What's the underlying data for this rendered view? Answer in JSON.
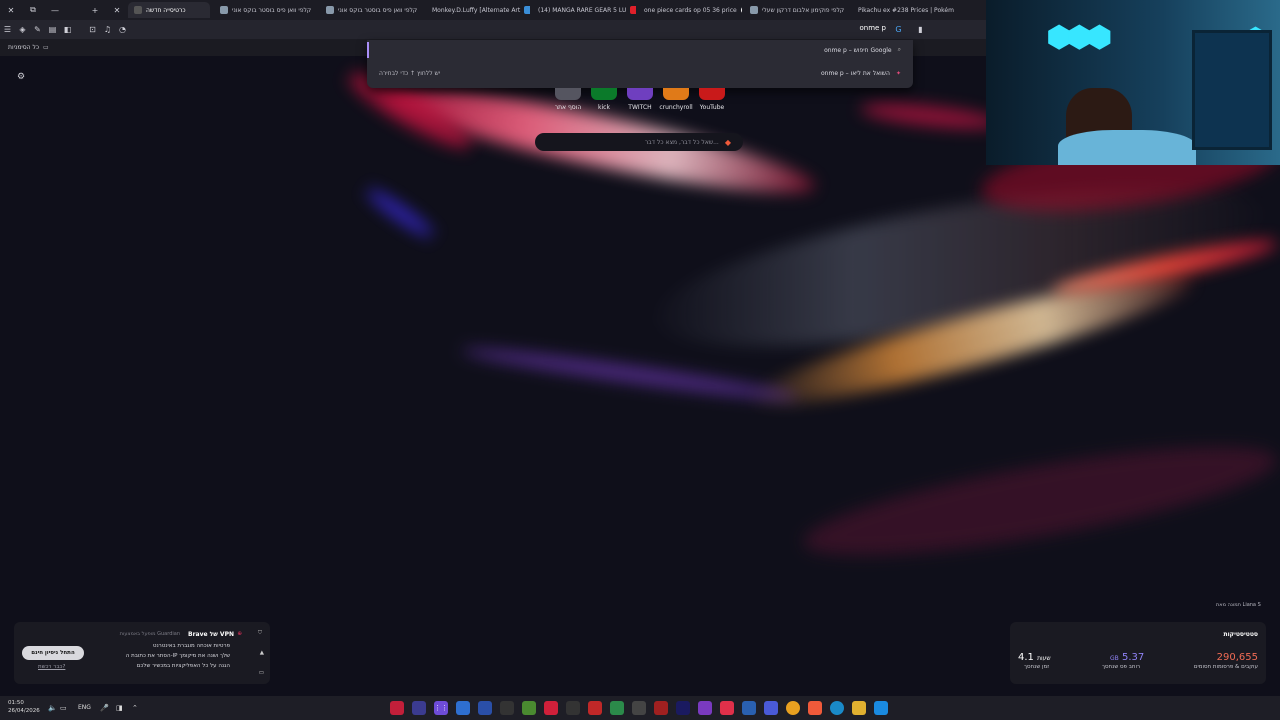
{
  "browser": {
    "tabs": [
      {
        "title": "כרטיסייה חדשה",
        "active": true
      },
      {
        "title": "קלפי וואן פיס בוסטר בוקס אוני"
      },
      {
        "title": "קלפי וואן פיס בוסטר בוקס אוני"
      },
      {
        "title": "Monkey.D.Luffy [Alternate Art"
      },
      {
        "title": "(14) MANGA RARE GEAR 5 LU"
      },
      {
        "title": "one piece cards op 05 36 price"
      },
      {
        "title": "קלפי פוקימון אלבום דרקון שעלי"
      },
      {
        "title": "Pikachu ex #238 Prices | Pokém"
      }
    ],
    "address_value": "onme p",
    "bookmarks_label": "כל הסימניות",
    "suggestions": [
      {
        "text": "onme p – חיפוש Google",
        "icon": "search-icon"
      },
      {
        "text": "onme p – השואל את ליאו",
        "sub": "יש ללחוץ ↑ כדי לבחירה",
        "icon": "leo-icon"
      }
    ]
  },
  "newtab": {
    "shortcuts": [
      {
        "label": "הוסף אתר",
        "color": "#555560"
      },
      {
        "label": "kick",
        "color": "#0b7a2a"
      },
      {
        "label": "TWITCH",
        "color": "#6f3fbf"
      },
      {
        "label": "crunchyroll",
        "color": "#e07a18"
      },
      {
        "label": "YouTube",
        "color": "#c91a1a"
      }
    ],
    "ask_placeholder": "שאל כל דבר, מצא כל דבר...",
    "photo_credit": "תמונה מאת Liana S"
  },
  "vpn_widget": {
    "title": "Brave של VPN",
    "guardian": "מופעל באמצעות Guardian",
    "features": [
      "פרטיות אוכחה מוגברת באינטרנט",
      "הסתר את כתובת ה-IP שלך ושנה את מיקומך",
      "הגנה על כל האפליקציות במכשיר שלכם"
    ],
    "cta": "התחל ניסיון חינם",
    "link": "כבר רכשת?"
  },
  "stats_widget": {
    "title": "סטטיסטיקות",
    "items": [
      {
        "value": "290,655",
        "label": "עוקבים & פרסומות חסומים",
        "color": "#f06b54"
      },
      {
        "value": "5.37",
        "unit": "GB",
        "label": "רוחב פס שנחסך",
        "color": "#8f82f5"
      },
      {
        "value": "4.1",
        "unit": "שעות",
        "label": "זמן שנחסך",
        "color": "#ffffff"
      }
    ]
  },
  "taskbar": {
    "time": "01:50",
    "date": "26/04/2026",
    "lang": "ENG"
  }
}
